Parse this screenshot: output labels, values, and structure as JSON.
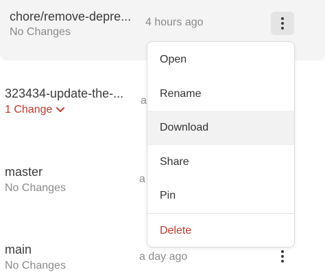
{
  "branches": [
    {
      "name": "chore/remove-depre...",
      "status": "No Changes",
      "time": "4 hours ago"
    },
    {
      "name": "323434-update-the-...",
      "status": "1 Change",
      "time": "a"
    },
    {
      "name": "master",
      "status": "No Changes",
      "time": "a"
    },
    {
      "name": "main",
      "status": "No Changes",
      "time": "a day ago"
    }
  ],
  "menu": {
    "items": [
      "Open",
      "Rename",
      "Download",
      "Share",
      "Pin"
    ],
    "delete": "Delete"
  },
  "icons": {
    "more": "kebab-vertical-icon",
    "chevron": "chevron-down-icon"
  },
  "colors": {
    "danger": "#c0392b",
    "highlight_row": "#f4f4f4",
    "menu_hover": "#f2f2f2"
  }
}
